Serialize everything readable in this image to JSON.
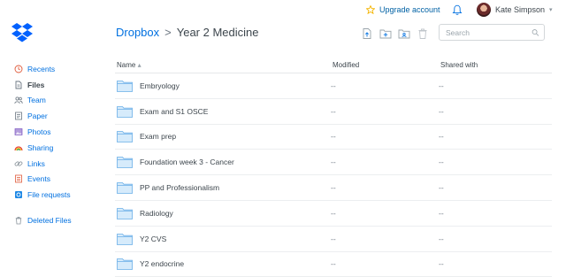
{
  "topbar": {
    "upgrade_label": "Upgrade account",
    "user_name": "Kate Simpson"
  },
  "breadcrumb": {
    "root": "Dropbox",
    "separator": ">",
    "current": "Year 2 Medicine"
  },
  "search": {
    "placeholder": "Search"
  },
  "sidebar": {
    "items": [
      {
        "label": "Recents",
        "icon": "clock-icon"
      },
      {
        "label": "Files",
        "icon": "files-icon",
        "active": true
      },
      {
        "label": "Team",
        "icon": "team-icon"
      },
      {
        "label": "Paper",
        "icon": "paper-icon"
      },
      {
        "label": "Photos",
        "icon": "photos-icon"
      },
      {
        "label": "Sharing",
        "icon": "sharing-icon"
      },
      {
        "label": "Links",
        "icon": "link-icon"
      },
      {
        "label": "Events",
        "icon": "events-icon"
      },
      {
        "label": "File requests",
        "icon": "file-request-icon"
      }
    ],
    "deleted": {
      "label": "Deleted Files",
      "icon": "trash-icon"
    }
  },
  "table": {
    "headers": {
      "name": "Name",
      "sort_indicator": "▴",
      "modified": "Modified",
      "shared": "Shared with"
    },
    "rows": [
      {
        "name": "Embryology",
        "modified": "--",
        "shared": "--"
      },
      {
        "name": "Exam and S1 OSCE",
        "modified": "--",
        "shared": "--"
      },
      {
        "name": "Exam prep",
        "modified": "--",
        "shared": "--"
      },
      {
        "name": "Foundation week 3 - Cancer",
        "modified": "--",
        "shared": "--"
      },
      {
        "name": "PP and Professionalism",
        "modified": "--",
        "shared": "--"
      },
      {
        "name": "Radiology",
        "modified": "--",
        "shared": "--"
      },
      {
        "name": "Y2 CVS",
        "modified": "--",
        "shared": "--"
      },
      {
        "name": "Y2 endocrine",
        "modified": "--",
        "shared": "--"
      }
    ]
  },
  "colors": {
    "accent": "#0070e0",
    "folder": "#8ec3f0",
    "star": "#f4b400"
  }
}
